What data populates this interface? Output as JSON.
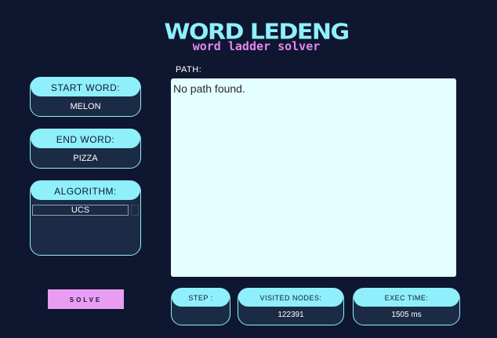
{
  "header": {
    "title": "WORD LEDENG",
    "subtitle": "word ladder solver"
  },
  "start_word": {
    "label": "START WORD:",
    "value": "MELON"
  },
  "end_word": {
    "label": "END WORD:",
    "value": "PIZZA"
  },
  "algorithm": {
    "label": "ALGORITHM:",
    "selected": "UCS"
  },
  "path": {
    "label": "PATH:",
    "text": "No path found."
  },
  "solve_label": "SOLVE",
  "stats": {
    "step": {
      "label": "STEP :",
      "value": ""
    },
    "visited": {
      "label": "VISITED NODES:",
      "value": "122391"
    },
    "exec": {
      "label": "EXEC TIME:",
      "value": "1505 ms"
    }
  },
  "colors": {
    "background": "#0f1630",
    "accent_cyan": "#8ff0fb",
    "accent_pink": "#e89df2",
    "card": "#1c2b45",
    "path_box": "#e3ffff"
  },
  "icons": {
    "select_arrow": "chevron-down-icon"
  }
}
